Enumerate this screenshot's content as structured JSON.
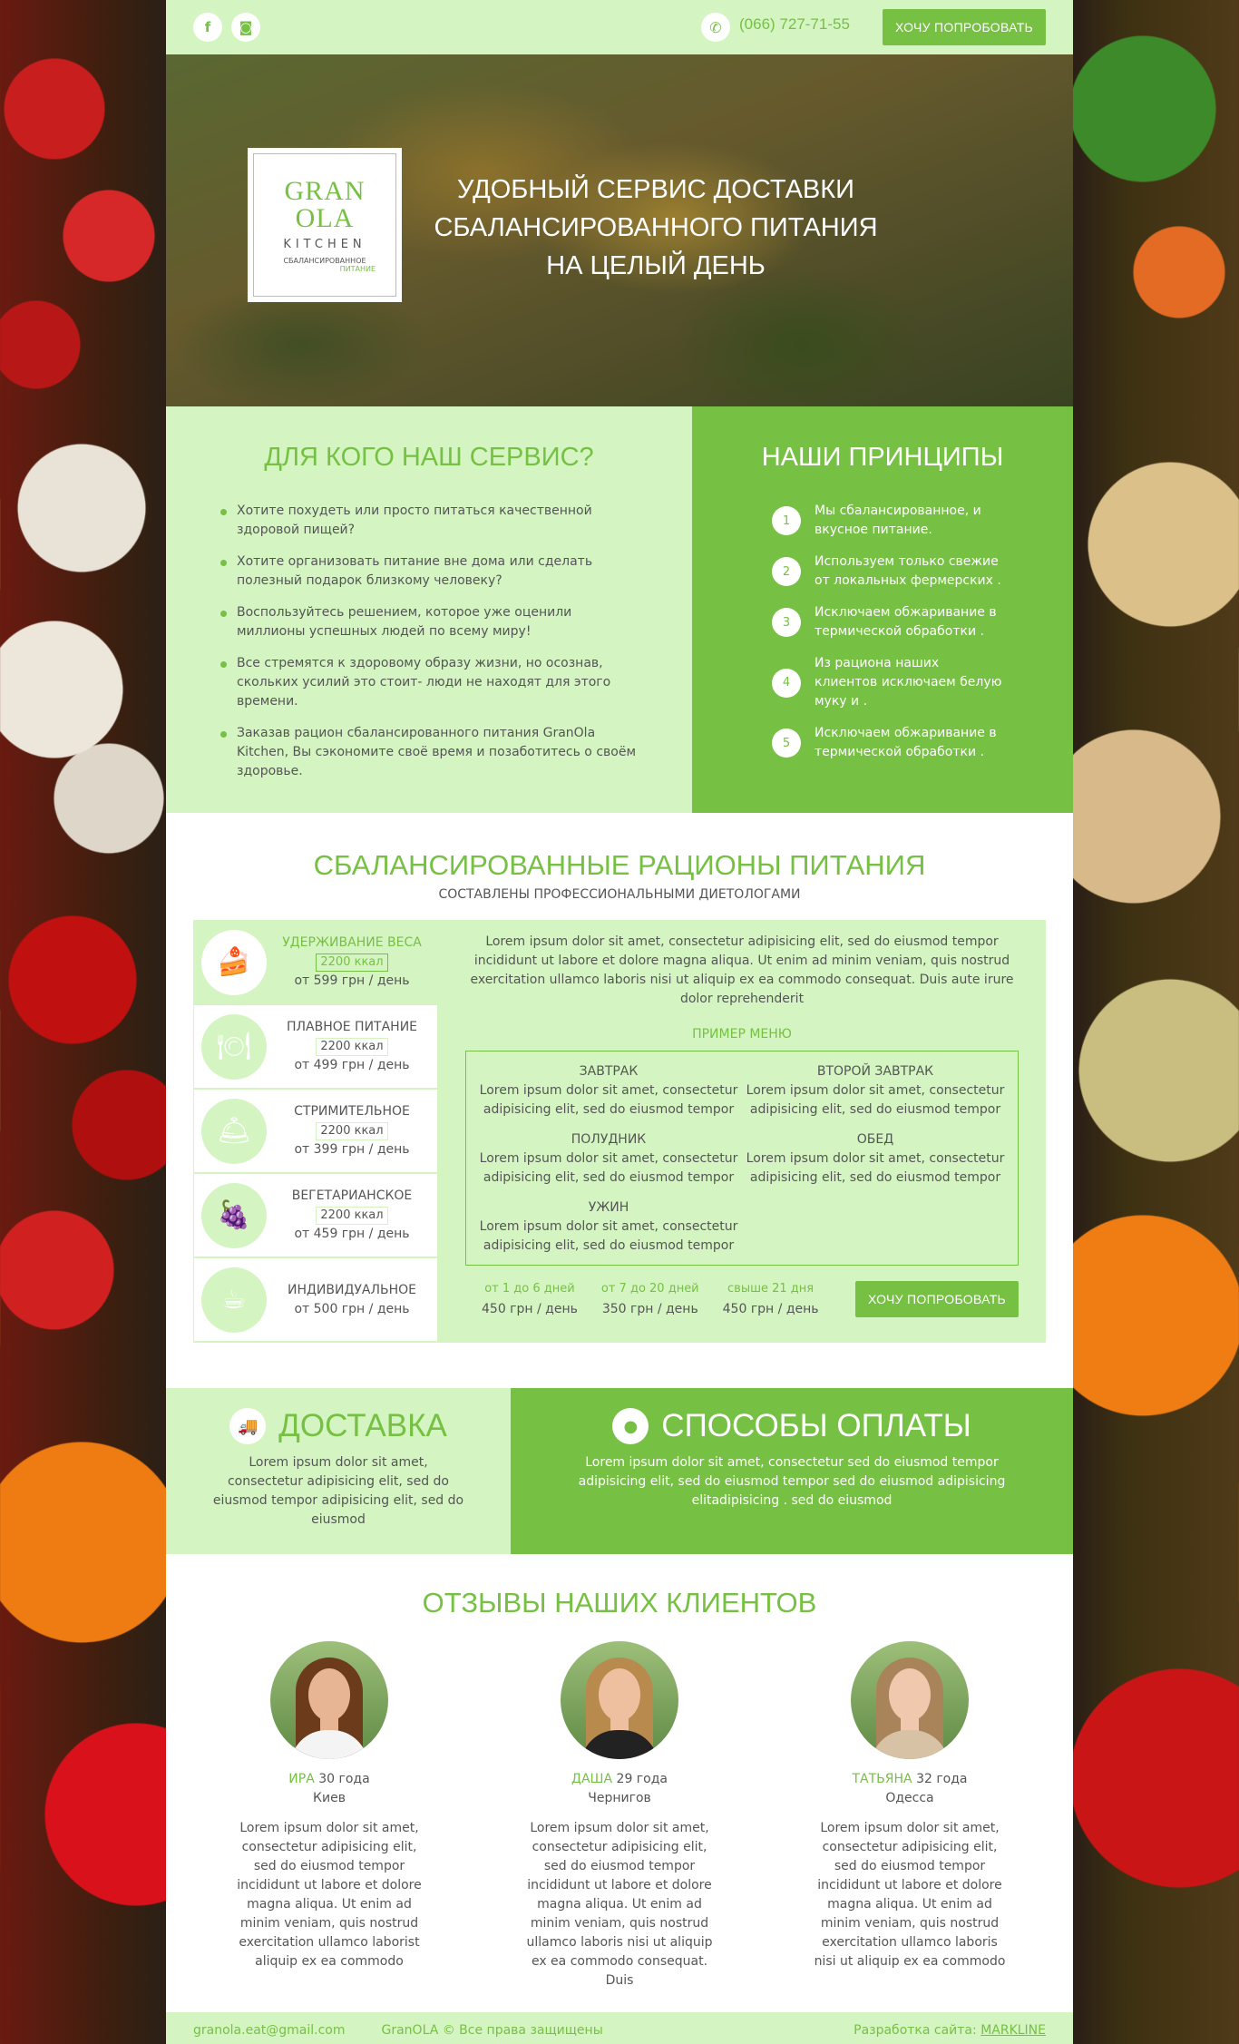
{
  "topbar": {
    "social": [
      {
        "icon": "facebook-icon",
        "glyph": "f"
      },
      {
        "icon": "instagram-icon",
        "glyph": "◙"
      }
    ],
    "phone": "(066) 727-71-55",
    "cta": "ХОЧУ ПОПРОБОВАТЬ"
  },
  "hero": {
    "logo": {
      "gran": "GRAN",
      "ola": "OLA",
      "kitchen": "KITCHEN",
      "sub1": "СБАЛАНСИРОВАННОЕ",
      "sub2": "ПИТАНИЕ"
    },
    "title_line1": "УДОБНЫЙ СЕРВИС ДОСТАВКИ",
    "title_line2": "СБАЛАНСИРОВАННОГО ПИТАНИЯ",
    "title_line3": "НА ЦЕЛЫЙ ДЕНЬ"
  },
  "who": {
    "title": "ДЛЯ КОГО НАШ СЕРВИС?",
    "items": [
      "Хотите похудеть или просто питаться качественной здоровой пищей?",
      "Хотите организовать питание вне дома или сделать полезный подарок близкому человеку?",
      "Воспользуйтесь решением, которое уже оценили миллионы успешных людей по всему миру!",
      "Все стремятся к здоровому образу жизни, но осознав, скольких усилий это стоит- люди не находят для этого времени.",
      "Заказав рацион сбалансированного питания GranOla Kitchen, Вы сэкономите своё время и позаботитесь о своём здоровье."
    ]
  },
  "principles": {
    "title": "НАШИ ПРИНЦИПЫ",
    "items": [
      {
        "num": "1",
        "text": "Мы сбалансированное, и вкусное питание."
      },
      {
        "num": "2",
        "text": "Используем только свежие от локальных фермерских ."
      },
      {
        "num": "3",
        "text": "Исключаем обжаривание в термической обработки ."
      },
      {
        "num": "4",
        "text": "Из рациона наших клиентов исключаем белую муку и ."
      },
      {
        "num": "5",
        "text": "Исключаем обжаривание в термической обработки ."
      }
    ]
  },
  "rations": {
    "title": "СБАЛАНСИРОВАННЫЕ РАЦИОНЫ ПИТАНИЯ",
    "subtitle": "СОСТАВЛЕНЫ ПРОФЕССИОНАЛЬНЫМИ ДИЕТОЛОГАМИ",
    "tabs": [
      {
        "name": "УДЕРЖИВАНИЕ ВЕСА",
        "kcal": "2200 ккал",
        "price": "от 599 грн / день",
        "icon": "cake-icon",
        "glyph": "🍰"
      },
      {
        "name": "ПЛАВНОЕ ПИТАНИЕ",
        "kcal": "2200 ккал",
        "price": "от 499 грн / день",
        "icon": "plate-icon",
        "glyph": "🍽"
      },
      {
        "name": "СТРИМИТЕЛЬНОЕ",
        "kcal": "2200 ккал",
        "price": "от 399 грн / день",
        "icon": "cloche-icon",
        "glyph": "🛎"
      },
      {
        "name": "ВЕГЕТАРИАНСКОЕ",
        "kcal": "2200 ккал",
        "price": "от 459 грн / день",
        "icon": "fruit-icon",
        "glyph": "🍇"
      },
      {
        "name": "ИНДИВИДУАЛЬНОЕ",
        "kcal": "",
        "price": "от 500 грн / день",
        "icon": "cup-icon",
        "glyph": "☕"
      }
    ],
    "description": "Lorem ipsum dolor sit amet, consectetur adipisicing elit, sed do eiusmod tempor incididunt ut labore et dolore magna aliqua. Ut enim ad minim veniam, quis nostrud exercitation ullamco laboris nisi ut aliquip ex ea commodo consequat. Duis aute irure dolor reprehenderit",
    "menu_title": "ПРИМЕР МЕНЮ",
    "meals": [
      {
        "name": "ЗАВТРАК",
        "text": "Lorem ipsum dolor sit amet, consectetur adipisicing elit, sed do eiusmod tempor"
      },
      {
        "name": "ВТОРОЙ ЗАВТРАК",
        "text": "Lorem ipsum dolor sit amet, consectetur adipisicing elit, sed do eiusmod tempor"
      },
      {
        "name": "ПОЛУДНИК",
        "text": "Lorem ipsum dolor sit amet, consectetur adipisicing elit, sed do eiusmod tempor"
      },
      {
        "name": "ОБЕД",
        "text": "Lorem ipsum dolor sit amet, consectetur adipisicing elit, sed do eiusmod tempor"
      },
      {
        "name": "УЖИН",
        "text": "Lorem ipsum dolor sit amet, consectetur adipisicing elit, sed do eiusmod tempor"
      }
    ],
    "prices": [
      {
        "range": "от 1 до 6 дней",
        "value": "450 грн / день"
      },
      {
        "range": "от 7 до 20 дней",
        "value": "350 грн / день"
      },
      {
        "range": "свыше 21 дня",
        "value": "450 грн / день"
      }
    ],
    "cta": "ХОЧУ ПОПРОБОВАТЬ"
  },
  "delivery": {
    "title": "ДОСТАВКА",
    "text": "Lorem ipsum dolor sit amet, consectetur adipisicing elit, sed do eiusmod tempor adipisicing elit, sed do eiusmod"
  },
  "payment": {
    "title": "СПОСОБЫ ОПЛАТЫ",
    "text": "Lorem ipsum dolor sit amet, consectetur  sed do eiusmod tempor adipisicing elit, sed do eiusmod tempor  sed do eiusmod adipisicing elitadipisicing . sed do eiusmod"
  },
  "reviews": {
    "title": "ОТЗЫВЫ НАШИХ КЛИЕНТОВ",
    "items": [
      {
        "name": "ИРА",
        "age": "30 года",
        "city": "Киев",
        "text": "Lorem ipsum dolor sit amet, consectetur adipisicing elit, sed do eiusmod tempor incididunt ut labore et dolore magna aliqua. Ut enim ad minim veniam, quis nostrud exercitation ullamco laborist aliquip ex ea commodo",
        "hair": "#6b3b1c",
        "skin": "#e8b594",
        "shirt": "#f4f4f4"
      },
      {
        "name": "ДАША",
        "age": "29 года",
        "city": "Чернигов",
        "text": "Lorem ipsum dolor sit amet, consectetur adipisicing elit, sed do eiusmod tempor incididunt ut labore et dolore magna aliqua. Ut enim ad minim veniam, quis nostrud ullamco laboris nisi ut aliquip ex ea commodo consequat. Duis",
        "hair": "#b98a4e",
        "skin": "#eec0a0",
        "shirt": "#222222"
      },
      {
        "name": "ТАТЬЯНА",
        "age": "32 года",
        "city": "Одесса",
        "text": "Lorem ipsum dolor sit amet, consectetur adipisicing elit, sed do eiusmod tempor incididunt ut labore et dolore magna aliqua. Ut enim ad minim veniam, quis nostrud exercitation ullamco laboris nisi ut aliquip ex ea commodo",
        "hair": "#a9845a",
        "skin": "#efc8ae",
        "shirt": "#d8c2a6"
      }
    ]
  },
  "footer": {
    "email": "granola.eat@gmail.com",
    "copyright": "GranOLA © Все права защищены",
    "dev_label": "Разработка сайта:",
    "dev_link": "MARKLINE"
  },
  "colors": {
    "accent": "#76c043",
    "light": "#d4f5c2",
    "text": "#555555"
  }
}
